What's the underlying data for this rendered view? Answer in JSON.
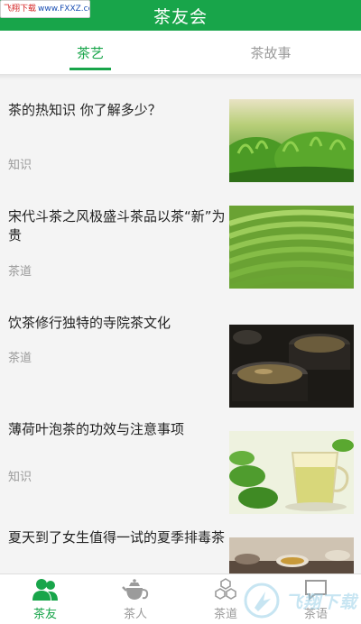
{
  "watermark_top": {
    "brand": "飞翔下载",
    "url": "www.FXXZ.com"
  },
  "header": {
    "title": "茶友会"
  },
  "tabs": [
    {
      "label": "茶艺",
      "active": true
    },
    {
      "label": "茶故事",
      "active": false
    }
  ],
  "articles": [
    {
      "title": "茶的热知识 你了解多少？",
      "tag": "知识",
      "image": "tea-plantation-image"
    },
    {
      "title": "宋代斗茶之风极盛斗茶品以茶“新”为贵",
      "tag": "茶道",
      "image": "tea-terrace-image"
    },
    {
      "title": "饮茶修行独特的寺院茶文化",
      "tag": "茶道",
      "image": "dark-tea-cups-image"
    },
    {
      "title": "薄荷叶泡茶的功效与注意事项",
      "tag": "知识",
      "image": "mint-tea-cup-image"
    },
    {
      "title": "夏天到了女生值得一试的夏季排毒茶",
      "tag": "",
      "image": "tea-set-image"
    }
  ],
  "bottom_nav": [
    {
      "label": "茶友",
      "icon": "people-icon",
      "active": true
    },
    {
      "label": "茶人",
      "icon": "teapot-icon",
      "active": false
    },
    {
      "label": "茶道",
      "icon": "hexagons-icon",
      "active": false
    },
    {
      "label": "茶语",
      "icon": "chat-icon",
      "active": false
    }
  ],
  "watermark_br": {
    "text": "飞翔下载"
  },
  "colors": {
    "accent": "#18a54a",
    "muted": "#9b9b9b",
    "background": "#f4f4f4"
  }
}
